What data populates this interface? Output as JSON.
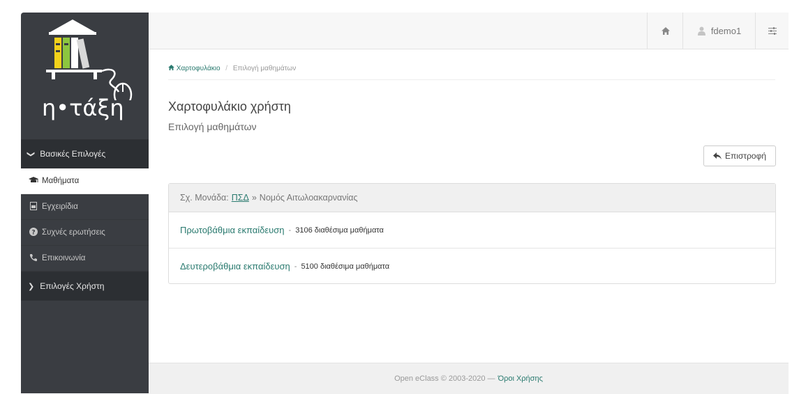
{
  "brand": {
    "logo_text": "η•τάξη"
  },
  "sidebar": {
    "section_main": {
      "label": "Βασικές Επιλογές",
      "icon": "chevron-down-icon"
    },
    "items": [
      {
        "label": "Μαθήματα",
        "icon": "graduation-cap-icon",
        "active": true
      },
      {
        "label": "Εγχειρίδια",
        "icon": "file-icon"
      },
      {
        "label": "Συχνές ερωτήσεις",
        "icon": "question-circle-icon"
      },
      {
        "label": "Επικοινωνία",
        "icon": "phone-icon"
      }
    ],
    "section_user": {
      "label": "Επιλογές Χρήστη",
      "icon": "chevron-right-icon"
    }
  },
  "topbar": {
    "username": "fdemo1"
  },
  "breadcrumb": {
    "home": "Χαρτοφυλάκιο",
    "current": "Επιλογή μαθημάτων"
  },
  "page": {
    "title": "Χαρτοφυλάκιο χρήστη",
    "subtitle": "Επιλογή μαθημάτων",
    "back_label": "Επιστροφή"
  },
  "panel": {
    "head_prefix": "Σχ. Μονάδα:",
    "head_link": "ΠΣΔ",
    "head_sep": "»",
    "head_region": "Νομός Αιτωλοακαρνανίας",
    "rows": [
      {
        "link": "Πρωτοβάθμια εκπαίδευση",
        "count": "3106 διαθέσιμα μαθήματα"
      },
      {
        "link": "Δευτεροβάθμια εκπαίδευση",
        "count": "5100 διαθέσιμα μαθήματα"
      }
    ]
  },
  "footer": {
    "text": "Open eClass © 2003-2020 —",
    "link": "Όροι Χρήσης"
  },
  "colors": {
    "sidebar_bg": "#3a3d42",
    "link": "#2a7a6f",
    "logo_yellow": "#f3d21a",
    "logo_green": "#8cc63f"
  }
}
